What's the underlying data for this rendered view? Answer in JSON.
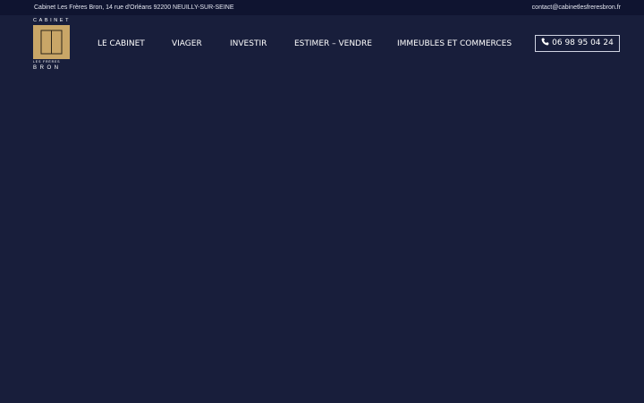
{
  "topbar": {
    "address": "Cabinet Les Frères Bron, 14 rue d'Orléans 92200 NEUILLY-SUR-SEINE",
    "email": "contact@cabinetlesfreresbron.fr"
  },
  "logo": {
    "top_text": "CABINET",
    "sub_text": "LES FRÈRES",
    "name_text": "BRON",
    "monogram": "FB"
  },
  "nav": {
    "items": [
      {
        "label": "LE CABINET"
      },
      {
        "label": "VIAGER"
      },
      {
        "label": "INVESTIR"
      },
      {
        "label": "ESTIMER – VENDRE"
      },
      {
        "label": "IMMEUBLES ET COMMERCES"
      }
    ]
  },
  "phone": {
    "label": "06 98 95 04 24",
    "icon": "phone-icon"
  },
  "colors": {
    "background": "#181e3b",
    "topbar": "#0f1430",
    "logo_gold": "#c9a667"
  }
}
